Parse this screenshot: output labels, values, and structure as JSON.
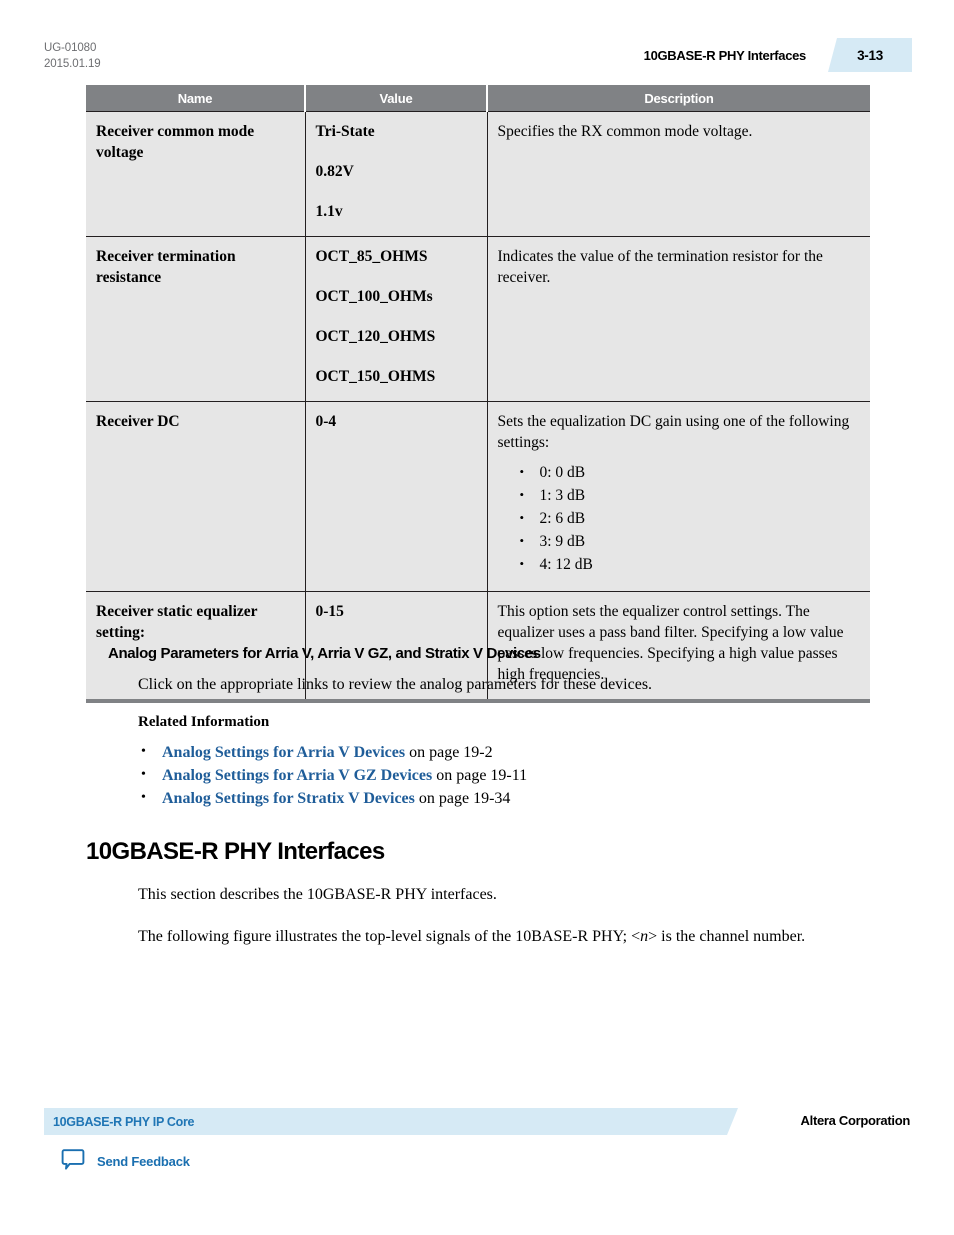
{
  "header": {
    "doc_number": "UG-01080",
    "doc_date": "2015.01.19",
    "chapter_title": "10GBASE-R PHY Interfaces",
    "page_number": "3-13",
    "badge_color": "#d6eaf5"
  },
  "table": {
    "columns": [
      "Name",
      "Value",
      "Description"
    ],
    "header_bg": "#808285",
    "row_bg": "#e6e6e6",
    "rows": [
      {
        "name": "Receiver common mode voltage",
        "values": [
          "Tri-State",
          "0.82V",
          "1.1v"
        ],
        "description": "Specifies the RX common mode voltage.",
        "bullets": []
      },
      {
        "name": "Receiver termination resistance",
        "values": [
          "OCT_85_OHMS",
          "OCT_100_OHMs",
          "OCT_120_OHMS",
          "OCT_150_OHMS"
        ],
        "description": "Indicates the value of the termination resistor for the receiver.",
        "bullets": []
      },
      {
        "name": "Receiver DC",
        "values": [
          "0-4"
        ],
        "description": "Sets the equalization DC gain using one of the following settings:",
        "bullets": [
          "0: 0 dB",
          "1: 3 dB",
          "2: 6 dB",
          "3: 9 dB",
          "4: 12 dB"
        ]
      },
      {
        "name": "Receiver static equalizer setting:",
        "values": [
          "0-15"
        ],
        "description": "This option sets the equalizer control settings. The equalizer uses a pass band filter. Specifying a low value passes low frequencies. Specifying a high value passes high frequencies.",
        "bullets": []
      }
    ]
  },
  "section": {
    "heading": "Analog Parameters for Arria V, Arria V GZ, and Stratix V Devices",
    "paragraph": "Click on the appropriate links to review the analog parameters for these devices.",
    "related_title": "Related Information",
    "related_links": [
      {
        "link_text": "Analog Settings for Arria V Devices",
        "suffix": " on page 19-2"
      },
      {
        "link_text": "Analog Settings for Arria V GZ Devices",
        "suffix": " on page 19-11"
      },
      {
        "link_text": "Analog Settings for Stratix V Devices",
        "suffix": " on page 19-34"
      }
    ],
    "link_color": "#1f5d99"
  },
  "main": {
    "heading": "10GBASE-R PHY Interfaces",
    "paragraph1": "This section describes the 10GBASE-R PHY interfaces.",
    "paragraph2_before": "The following figure illustrates the top-level signals of the 10BASE-R PHY; <",
    "paragraph2_italic": "n",
    "paragraph2_after": "> is the channel number."
  },
  "footer": {
    "ip_core_label": "10GBASE-R PHY IP Core",
    "corporation": "Altera Corporation",
    "feedback_label": "Send Feedback",
    "bar_color": "#d6eaf5"
  }
}
